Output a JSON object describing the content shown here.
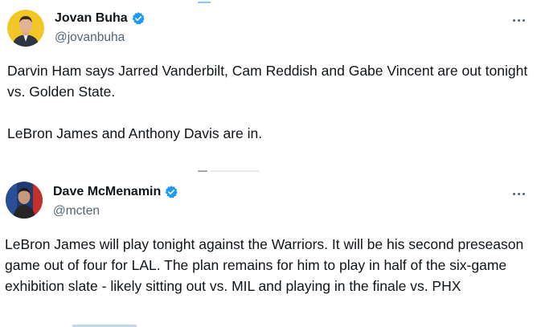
{
  "tweets": [
    {
      "display_name": "Jovan Buha",
      "handle": "@jovanbuha",
      "verified": true,
      "paragraphs": [
        "Darvin Ham says Jarred Vanderbilt, Cam Reddish and Gabe Vincent are out tonight vs. Golden State.",
        "LeBron James and Anthony Davis are in."
      ]
    },
    {
      "display_name": "Dave McMenamin",
      "handle": "@mcten",
      "verified": true,
      "paragraphs": [
        "LeBron James will play tonight against the Warriors. It will be his second preseason game out of four for LAL. The plan remains for him to play in half of the six-game exhibition slate - likely sitting out vs. MIL and playing in the finale vs. PHX"
      ]
    }
  ],
  "colors": {
    "text_primary": "#0f1419",
    "text_secondary": "#536471",
    "verified_blue": "#1d9bf0",
    "background": "#ffffff"
  },
  "icons": {
    "verified": "verified-badge-icon",
    "more": "more-options-icon"
  }
}
